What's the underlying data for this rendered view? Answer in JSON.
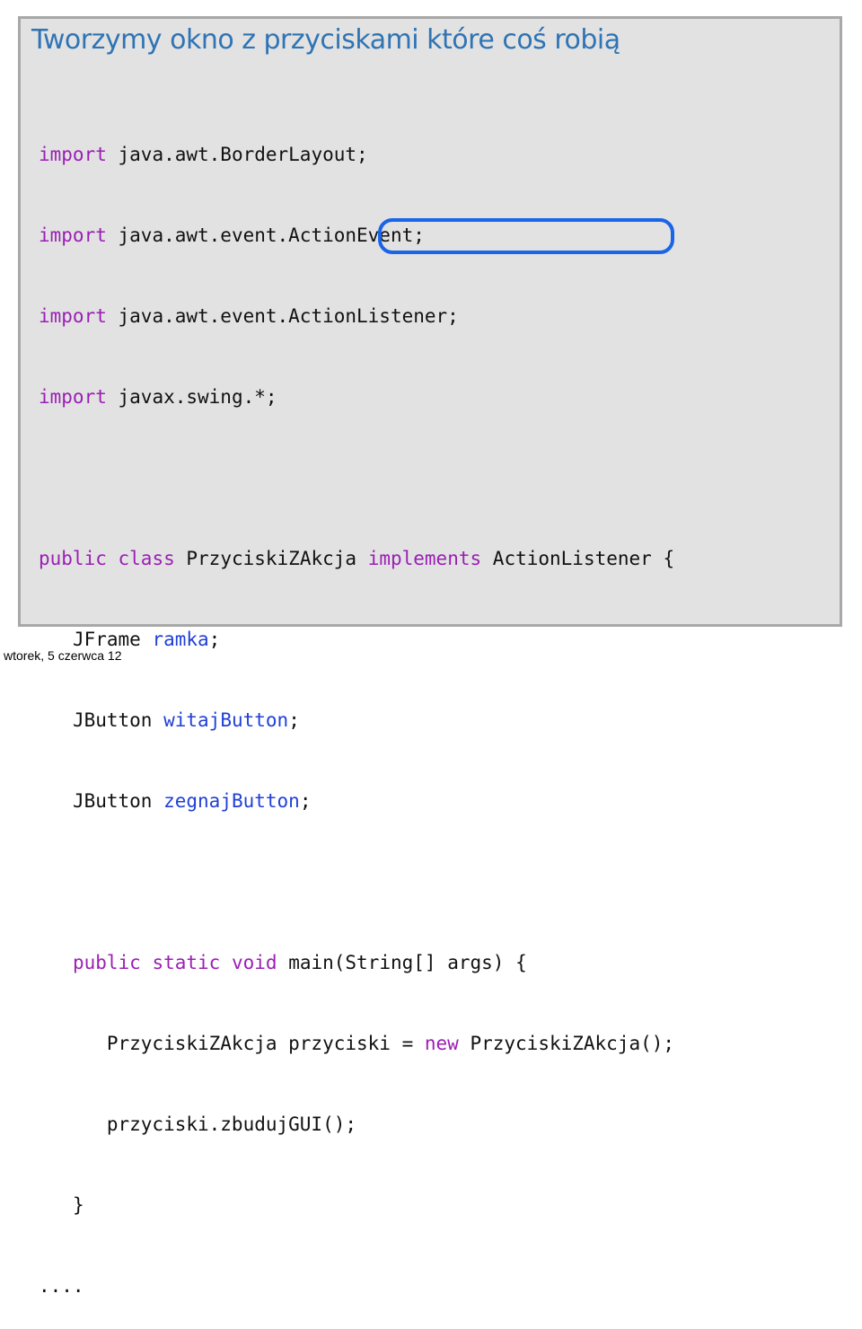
{
  "slide": {
    "title": "Tworzymy okno z przyciskami które coś robią"
  },
  "code": {
    "imports": [
      {
        "keyword": "import",
        "path": "java.awt.BorderLayout;"
      },
      {
        "keyword": "import",
        "path": "java.awt.event.ActionEvent;"
      },
      {
        "keyword": "import",
        "path": "java.awt.event.ActionListener;"
      },
      {
        "keyword": "import",
        "path": "javax.swing.*;"
      }
    ],
    "class_decl": {
      "public": "public",
      "class": "class",
      "name": "PrzyciskiZAkcja",
      "implements": "implements",
      "interface": "ActionListener",
      "brace": "{"
    },
    "fields": [
      {
        "type": "JFrame",
        "name": "ramka",
        "end": ";"
      },
      {
        "type": "JButton",
        "name": "witajButton",
        "end": ";"
      },
      {
        "type": "JButton",
        "name": "zegnajButton",
        "end": ";"
      }
    ],
    "main_decl": {
      "public": "public",
      "static": "static",
      "void": "void",
      "signature": "main(String[] args) {"
    },
    "main_body": {
      "line1_type": "PrzyciskiZAkcja przyciski = ",
      "line1_new": "new",
      "line1_rest": " PrzyciskiZAkcja();",
      "line2": "przyciski.zbudujGUI();"
    },
    "close_brace": "}",
    "ellipsis": "...."
  },
  "colors": {
    "title": "#2f74b4",
    "keyword": "#9b1fb5",
    "identifier": "#2140d6",
    "highlight_oval": "#1a64e8",
    "slide_background": "#e2e2e2"
  },
  "footer": {
    "date": "wtorek, 5 czerwca 12"
  }
}
